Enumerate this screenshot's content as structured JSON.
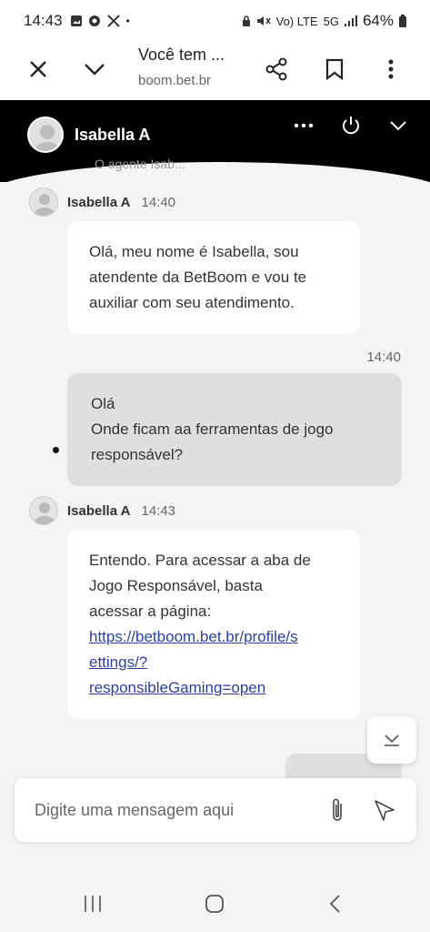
{
  "status_bar": {
    "time": "14:43",
    "battery": "64%",
    "network": "5G",
    "volte": "Vo) LTE"
  },
  "browser": {
    "title": "Você tem ...",
    "url": "boom.bet.br"
  },
  "chat_header": {
    "agent_name": "Isabella A",
    "ghost_text": "O agente Isab..."
  },
  "messages": [
    {
      "sender": "Isabella A",
      "time": "14:40",
      "lines": [
        "Olá, meu nome é Isabella, sou",
        "atendente da BetBoom e vou te",
        "auxiliar com seu atendimento."
      ]
    },
    {
      "time": "14:40",
      "lines": [
        "Olá",
        "Onde ficam aa ferramentas de jogo",
        "responsável?"
      ]
    },
    {
      "sender": "Isabella A",
      "time": "14:43",
      "lines": [
        "Entendo. Para acessar a aba de",
        "Jogo Responsável, basta",
        "acessar a página:"
      ],
      "link_lines": [
        "https://betboom.bet.br/profile/s",
        "ettings/?",
        "responsibleGaming=open"
      ]
    }
  ],
  "composer": {
    "placeholder": "Digite uma mensagem aqui"
  },
  "icons": {
    "close": "close-icon",
    "chevron": "chevron-down-icon",
    "share": "share-icon",
    "bookmark": "bookmark-icon",
    "menu": "more-vert-icon",
    "attach": "paperclip-icon",
    "send": "send-icon"
  }
}
